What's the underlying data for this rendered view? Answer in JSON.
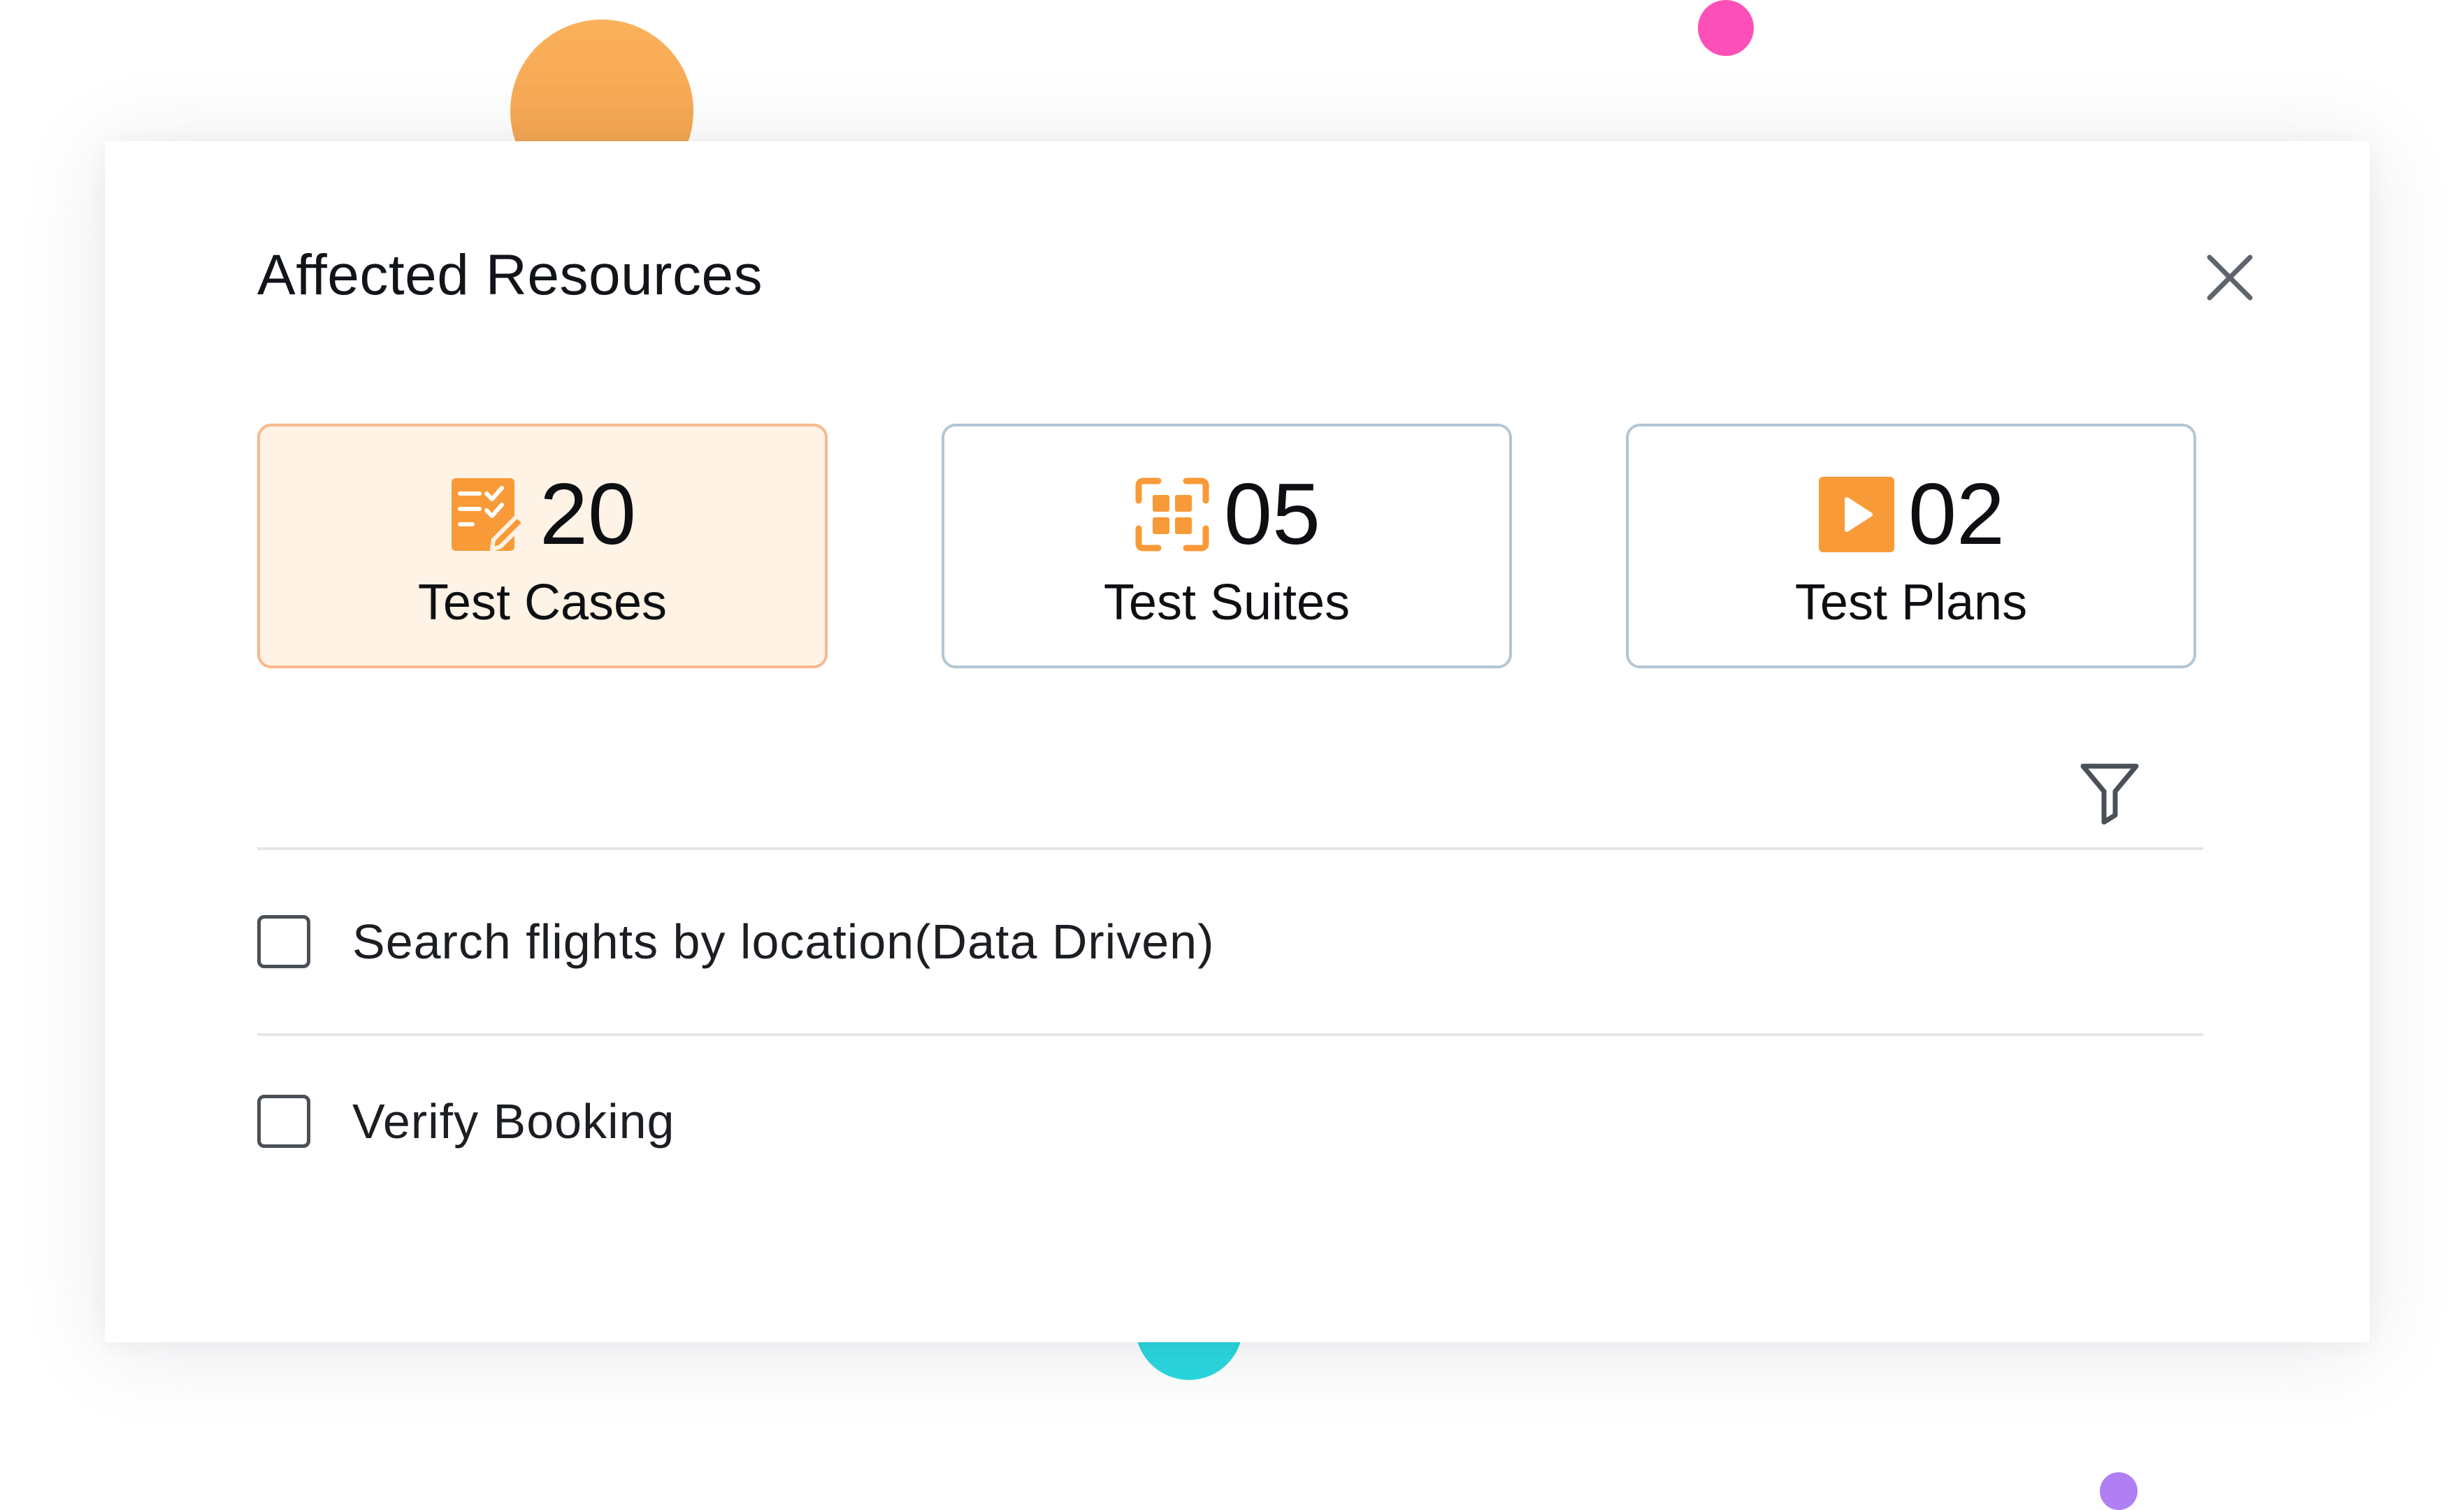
{
  "modal": {
    "title": "Affected Resources",
    "close_icon": "close-icon"
  },
  "resource_cards": [
    {
      "count": "20",
      "label": "Test Cases",
      "icon": "test-cases-icon",
      "selected": true
    },
    {
      "count": "05",
      "label": "Test Suites",
      "icon": "test-suites-icon",
      "selected": false
    },
    {
      "count": "02",
      "label": "Test Plans",
      "icon": "test-plans-icon",
      "selected": false
    }
  ],
  "filter": {
    "icon": "filter-icon"
  },
  "items": [
    {
      "label": "Search flights by location(Data Driven)",
      "checked": false
    },
    {
      "label": "Verify Booking",
      "checked": false
    }
  ],
  "colors": {
    "accent": "#f99a38",
    "active_card_bg": "#fff3e5",
    "active_card_border": "#f8b88c",
    "card_border": "#b3c7d4",
    "divider": "#e4e7ea"
  }
}
